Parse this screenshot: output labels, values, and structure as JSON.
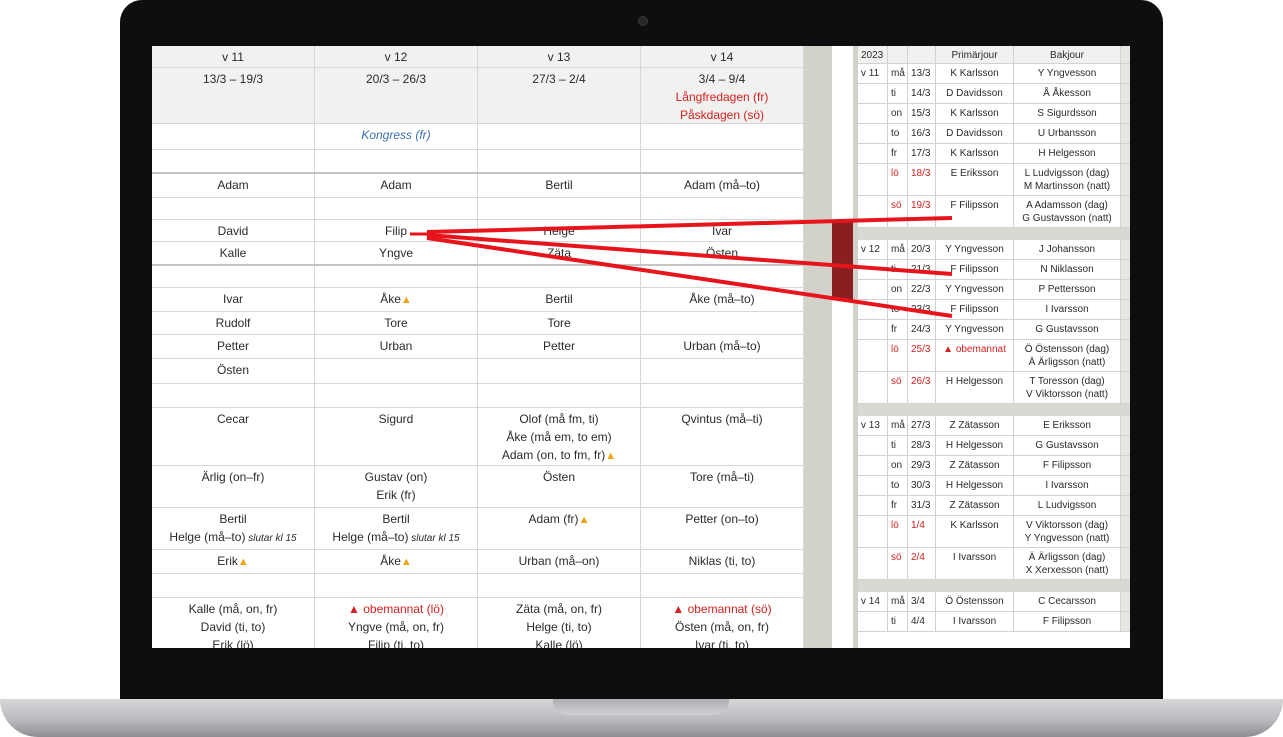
{
  "weeks": [
    {
      "week": "v 11",
      "range": "13/3 – 19/3",
      "holidays": []
    },
    {
      "week": "v 12",
      "range": "20/3 – 26/3",
      "holidays": []
    },
    {
      "week": "v 13",
      "range": "27/3 – 2/4",
      "holidays": []
    },
    {
      "week": "v 14",
      "range": "3/4 – 9/4",
      "holidays": [
        "Långfredagen (fr)",
        "Påskdagen (sö)"
      ]
    }
  ],
  "kongress": "Kongress (fr)",
  "rows": {
    "r1": [
      "Adam",
      "Adam",
      "Bertil",
      "Adam (må–to)"
    ],
    "r2": [
      "David",
      "Filip",
      "Helge",
      "Ivar"
    ],
    "r3": [
      "Kalle",
      "Yngve",
      "Zäta",
      "Östen"
    ],
    "r4": [
      "Ivar",
      "Åke",
      "Bertil",
      "Åke (må–to)"
    ],
    "r5": [
      "Rudolf",
      "Tore",
      "Tore",
      ""
    ],
    "r6": [
      "Petter",
      "Urban",
      "Petter",
      "Urban (må–to)"
    ],
    "r7": [
      "Östen",
      "",
      "",
      ""
    ],
    "r8": [
      [
        "Cecar"
      ],
      [
        "Sigurd"
      ],
      [
        "Olof (må fm, ti)",
        "Åke (må em, to em)",
        "Adam (on, to fm, fr)"
      ],
      [
        "Qvintus (må–ti)"
      ]
    ],
    "r9": [
      [
        "Ärlig (on–fr)"
      ],
      [
        "Gustav (on)",
        "Erik (fr)"
      ],
      [
        "Östen"
      ],
      [
        "Tore (må–ti)"
      ]
    ],
    "r10": [
      [
        "Bertil",
        "Helge (må–to)",
        "slutar kl 15"
      ],
      [
        "Bertil",
        "Helge (må–to)",
        "slutar kl 15"
      ],
      [
        "Adam (fr)"
      ],
      [
        "Petter (on–to)"
      ]
    ],
    "r11": [
      "Erik",
      "Åke",
      "Urban (må–on)",
      "Niklas (ti, to)"
    ],
    "r12": [
      [
        "Kalle (må, on, fr)",
        "David (ti, to)",
        "Erik (lö)"
      ],
      [
        "obemannat (lö)",
        "Yngve (må, on, fr)",
        "Filip (ti, to)"
      ],
      [
        "Zäta (må, on, fr)",
        "Helge (ti, to)",
        "Kalle (lö)"
      ],
      [
        "obemannat (sö)",
        "Östen (må, on, fr)",
        "Ivar (ti, to)"
      ]
    ]
  },
  "roster": {
    "year": "2023",
    "primary_header": "Primärjour",
    "backup_header": "Bakjour",
    "lines": [
      {
        "w": "v 11",
        "d": "må",
        "dt": "13/3",
        "p": "K Karlsson",
        "b": [
          "Y Yngvesson"
        ]
      },
      {
        "w": "",
        "d": "ti",
        "dt": "14/3",
        "p": "D Davidsson",
        "b": [
          "Å Åkesson"
        ]
      },
      {
        "w": "",
        "d": "on",
        "dt": "15/3",
        "p": "K Karlsson",
        "b": [
          "S Sigurdsson"
        ]
      },
      {
        "w": "",
        "d": "to",
        "dt": "16/3",
        "p": "D Davidsson",
        "b": [
          "U Urbansson"
        ]
      },
      {
        "w": "",
        "d": "fr",
        "dt": "17/3",
        "p": "K Karlsson",
        "b": [
          "H Helgesson"
        ]
      },
      {
        "w": "",
        "d": "lö",
        "dt": "18/3",
        "p": "E Eriksson",
        "b": [
          "L Ludvigsson (dag)",
          "M Martinsson (natt)"
        ]
      },
      {
        "w": "",
        "d": "sö",
        "dt": "19/3",
        "p": "F Filipsson",
        "b": [
          "A Adamsson (dag)",
          "G Gustavsson (natt)"
        ]
      },
      {
        "w": "v 12",
        "d": "må",
        "dt": "20/3",
        "p": "Y Yngvesson",
        "b": [
          "J Johansson"
        ]
      },
      {
        "w": "",
        "d": "ti",
        "dt": "21/3",
        "p": "F Filipsson",
        "b": [
          "N Niklasson"
        ]
      },
      {
        "w": "",
        "d": "on",
        "dt": "22/3",
        "p": "Y Yngvesson",
        "b": [
          "P Pettersson"
        ]
      },
      {
        "w": "",
        "d": "to",
        "dt": "23/3",
        "p": "F Filipsson",
        "b": [
          "I Ivarsson"
        ]
      },
      {
        "w": "",
        "d": "fr",
        "dt": "24/3",
        "p": "Y Yngvesson",
        "b": [
          "G Gustavsson"
        ]
      },
      {
        "w": "",
        "d": "lö",
        "dt": "25/3",
        "p": "obemannat",
        "b": [
          "Ö Östensson (dag)",
          "Ä Ärligsson (natt)"
        ]
      },
      {
        "w": "",
        "d": "sö",
        "dt": "26/3",
        "p": "H Helgesson",
        "b": [
          "T Toresson (dag)",
          "V Viktorsson (natt)"
        ]
      },
      {
        "w": "v 13",
        "d": "må",
        "dt": "27/3",
        "p": "Z Zätasson",
        "b": [
          "E Eriksson"
        ]
      },
      {
        "w": "",
        "d": "ti",
        "dt": "28/3",
        "p": "H Helgesson",
        "b": [
          "G Gustavsson"
        ]
      },
      {
        "w": "",
        "d": "on",
        "dt": "29/3",
        "p": "Z Zätasson",
        "b": [
          "F Filipsson"
        ]
      },
      {
        "w": "",
        "d": "to",
        "dt": "30/3",
        "p": "H Helgesson",
        "b": [
          "I Ivarsson"
        ]
      },
      {
        "w": "",
        "d": "fr",
        "dt": "31/3",
        "p": "Z Zätasson",
        "b": [
          "L Ludvigsson"
        ]
      },
      {
        "w": "",
        "d": "lö",
        "dt": "1/4",
        "p": "K Karlsson",
        "b": [
          "V Viktorsson (dag)",
          "Y Yngvesson (natt)"
        ]
      },
      {
        "w": "",
        "d": "sö",
        "dt": "2/4",
        "p": "I Ivarsson",
        "b": [
          "Ä Ärligsson (dag)",
          "X Xerxesson (natt)"
        ]
      },
      {
        "w": "v 14",
        "d": "må",
        "dt": "3/4",
        "p": "Ö Östensson",
        "b": [
          "C Cecarsson"
        ]
      },
      {
        "w": "",
        "d": "ti",
        "dt": "4/4",
        "p": "I Ivarsson",
        "b": [
          "F Filipsson"
        ]
      }
    ]
  },
  "colors": {
    "weekend_red": "#d52020",
    "link_line_red": "#e8141c",
    "warning_orange": "#f3a20e",
    "blue_note": "#3c6fb4"
  },
  "icons": {
    "warning": "warning-triangle-icon",
    "alert": "red-triangle-icon"
  }
}
